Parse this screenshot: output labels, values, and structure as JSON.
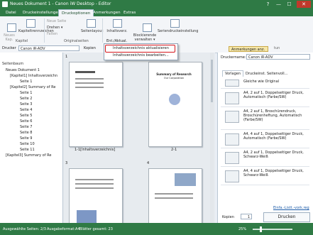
{
  "window": {
    "title": "Neues Dokument 1 - Canon iW Desktop - Editor",
    "help": "?",
    "minimize": "—",
    "maximize": "☐",
    "close": "✕"
  },
  "tabs": [
    "Datei",
    "Druckeinstellungen",
    "Druckoptionen",
    "Anmerkungen",
    "Extras"
  ],
  "ribbon": {
    "neues_kapitel": "Neues\nKap.",
    "kapiteltrenn": "Kapiteltrennzeichen",
    "neue_seite": "Neue Seite",
    "drehen": "Drehen ▾",
    "falten": "Falten",
    "seitenlayout": "Seitenlayout",
    "inhaltsverz": "Inhaltsverz.",
    "ent_aktual": "Ent./Aktual.",
    "blockierende": "Blockierende\nverwalten ▾",
    "seriendruck": "Seriendruckeinstellung",
    "group_kapitel": "Kapitel",
    "group_original": "Originalseiten"
  },
  "toolbar": {
    "drucker_label": "Drucker",
    "drucker_value": "Canon iR-ADV",
    "kopien_label": "Kopien",
    "anmerkungen_button": "Anmerkungen anz.",
    "extra": "tun"
  },
  "menu": {
    "item1": "Inhaltsverzeichnis aktualisieren",
    "item2": "Inhaltsverzeichnis bearbeiten..."
  },
  "leftpane": {
    "header": "Seitenbaum",
    "rows": [
      "Neues Dokument 1",
      "[Kapitel1] Inhaltsverzeichn",
      "Seite 1",
      "[Kapitel2] Summary of Re",
      "Seite 1",
      "Seite 2",
      "Seite 3",
      "Seite 4",
      "Seite 5",
      "Seite 6",
      "Seite 7",
      "Seite 8",
      "Seite 9",
      "Seite 10",
      "Seite 11",
      "[Kapitel3] Summary of Re"
    ]
  },
  "pages": {
    "p1_num": "1",
    "p1_label": "1-1[Inhaltsverzeichnis]",
    "p2_label": "2-1",
    "p3_num": "3",
    "p4_num": "4",
    "p2_title": "Summary of Research",
    "p2_sub": "Our Corporation"
  },
  "rightpane": {
    "drucker_label": "Druckername:",
    "drucker_value": "Canon iR-ADV",
    "tabs": [
      "Vorlagen",
      "Druckeinst.",
      "Seitenvoll..."
    ],
    "settings": [
      "Gleiche wie Original",
      "A4, 2 auf 1, Doppelseitiger Druck, Automatisch (Farbe/SW)",
      "A4, 2 auf 1, Broschürendruck, Broschürenheftung, Automatisch (Farbe/SW)",
      "A4, 4 auf 1, Doppelseitiger Druck, Automatisch (Farbe/SW)",
      "A4, 2 auf 1, Doppelseitiger Druck, Schwarz-Weiß",
      "A4, 4 auf 1, Doppelseitiger Druck, Schwarz-Weiß"
    ],
    "link": "Einfa.-Listt.-vork.reg",
    "kopien_label": "Kopien",
    "kopien_value": "1",
    "drucken": "Drucken"
  },
  "status": {
    "ausgewaehlt": "Ausgewählte Seiten: 2/3",
    "format": "Ausgabeformat:A4",
    "blaetter": "Blätter gesamt: 23",
    "zoom": "25%"
  },
  "colors": {
    "accent": "#2f7a45",
    "highlight": "#d4161c"
  }
}
